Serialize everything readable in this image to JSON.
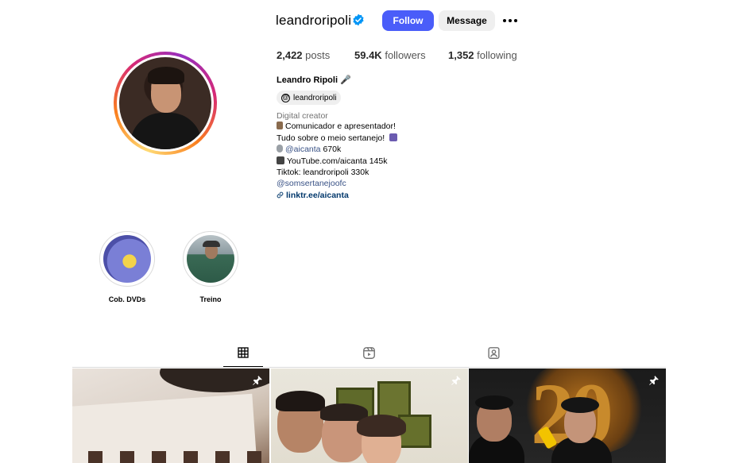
{
  "profile": {
    "username": "leandroripoli",
    "verified": true,
    "follow_label": "Follow",
    "message_label": "Message",
    "stats": {
      "posts_count": "2,422",
      "posts_label": "posts",
      "followers_count": "59.4K",
      "followers_label": "followers",
      "following_count": "1,352",
      "following_label": "following"
    },
    "full_name": "Leandro Ripoli 🎤",
    "threads_handle": "leandroripoli",
    "category": "Digital creator",
    "bio": {
      "line1": "Comunicador e apresentador!",
      "line2": "Tudo sobre o meio sertanejo!",
      "line3_link": "@aicanta",
      "line3_text": " 670k",
      "line4": "YouTube.com/aicanta 145k",
      "line5": "Tiktok: leandroripoli 330k",
      "line6_link": "@somsertanejoofc",
      "line7_link": "linktr.ee/aicanta"
    }
  },
  "highlights": [
    {
      "label": "Cob. DVDs"
    },
    {
      "label": "Treino"
    }
  ],
  "tabs": [
    {
      "icon": "grid-icon",
      "active": true
    },
    {
      "icon": "reels-icon",
      "active": false
    },
    {
      "icon": "tagged-icon",
      "active": false
    }
  ],
  "posts": [
    {
      "pinned": true,
      "icon": "pin-icon"
    },
    {
      "pinned": true,
      "icon": "pin-icon"
    },
    {
      "pinned": true,
      "icon": "pin-icon"
    }
  ],
  "post3_overlay_text": "20",
  "colors": {
    "follow_button": "#4a5df9",
    "verified_badge": "#0095f6",
    "link": "#385185"
  }
}
